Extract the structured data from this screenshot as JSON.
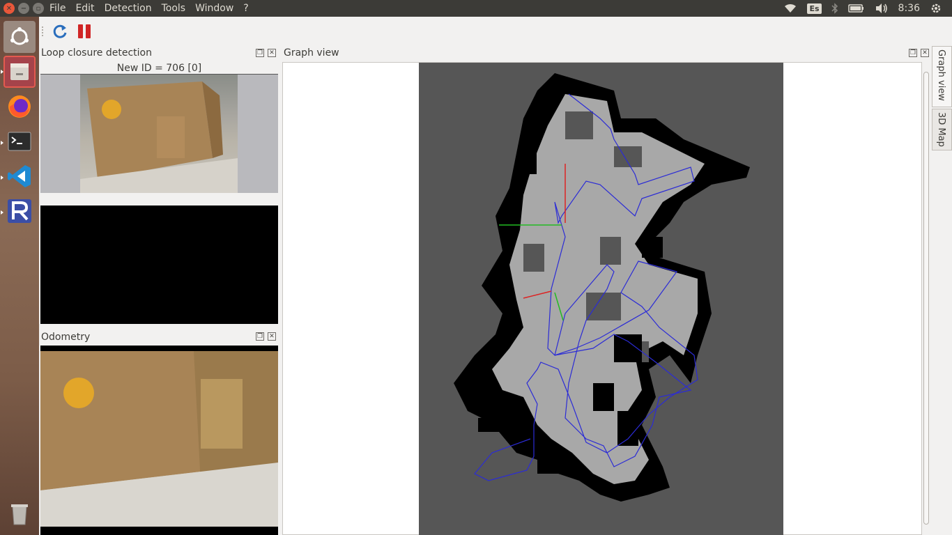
{
  "menubar": {
    "items": [
      "File",
      "Edit",
      "Detection",
      "Tools",
      "Window",
      "?"
    ]
  },
  "tray": {
    "keyboard": "Es",
    "clock": "8:36",
    "icons": [
      "wifi-icon",
      "keyboard-layout-icon",
      "bluetooth-icon",
      "battery-icon",
      "volume-icon",
      "power-gear-icon"
    ]
  },
  "launcher": {
    "items": [
      "ubuntu-dash",
      "files",
      "firefox",
      "terminal",
      "vscode",
      "rstudio",
      "trash"
    ]
  },
  "toolbar": {
    "buttons": [
      "refresh-icon",
      "pause-icon"
    ]
  },
  "loop_closure": {
    "title": "Loop closure detection",
    "status": "New ID = 706 [0]"
  },
  "odometry": {
    "title": "Odometry"
  },
  "graph_view": {
    "title": "Graph view"
  },
  "side_tabs": {
    "graph": "Graph view",
    "map3d": "3D Map"
  },
  "colors": {
    "grid_unknown": "#565656",
    "grid_free": "#a8a8a8",
    "grid_occupied": "#000000",
    "graph_path": "#2b2bd6",
    "link_red": "#dd2222",
    "link_green": "#22bb22"
  }
}
